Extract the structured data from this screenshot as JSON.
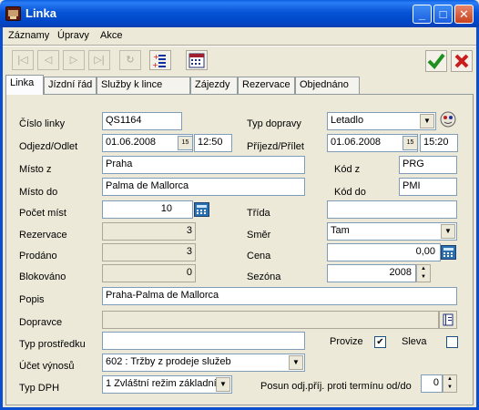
{
  "window": {
    "title": "Linka"
  },
  "menu": [
    "Záznamy",
    "Úpravy",
    "Akce"
  ],
  "tabs": [
    "Linka",
    "Jízdní řád",
    "Služby k lince",
    "Zájezdy",
    "Rezervace",
    "Objednáno"
  ],
  "labels": {
    "cislo_linky": "Číslo linky",
    "odjezd": "Odjezd/Odlet",
    "misto_z": "Místo z",
    "misto_do": "Místo do",
    "pocet_mist": "Počet míst",
    "rezervace": "Rezervace",
    "prodano": "Prodáno",
    "blokovano": "Blokováno",
    "popis": "Popis",
    "dopravce": "Dopravce",
    "typ_prostredku": "Typ prostředku",
    "ucet_vynosu": "Účet výnosů",
    "typ_dph": "Typ DPH",
    "typ_dopravy": "Typ dopravy",
    "prijezd": "Příjezd/Přílet",
    "kod_z": "Kód z",
    "kod_do": "Kód do",
    "trida": "Třída",
    "smer": "Směr",
    "cena": "Cena",
    "sezona": "Sezóna",
    "provize": "Provize",
    "sleva": "Sleva",
    "posun": "Posun odj.příj. proti termínu od/do"
  },
  "values": {
    "cislo_linky": "QS1164",
    "odjezd_datum": "01.06.2008",
    "odjezd_cas": "12:50",
    "misto_z": "Praha",
    "misto_do": "Palma de Mallorca",
    "pocet_mist": "10",
    "rezervace": "3",
    "prodano": "3",
    "blokovano": "0",
    "popis": "Praha-Palma de Mallorca",
    "dopravce": "",
    "typ_prostredku": "",
    "ucet_vynosu": "602    : Tržby z prodeje služeb",
    "typ_dph": "1 Zvláštní režim základní",
    "typ_dopravy": "Letadlo",
    "prijezd_datum": "01.06.2008",
    "prijezd_cas": "15:20",
    "kod_z": "PRG",
    "kod_do": "PMI",
    "trida": "",
    "smer": "Tam",
    "cena": "0,00",
    "sezona": "2008",
    "provize_checked": true,
    "sleva_checked": false,
    "posun": "0"
  },
  "icons": {
    "calendar_day": "15"
  },
  "colors": {
    "accent": "#0a5fe0",
    "confirm": "#1f8f1f",
    "cancel": "#c81e1e"
  }
}
